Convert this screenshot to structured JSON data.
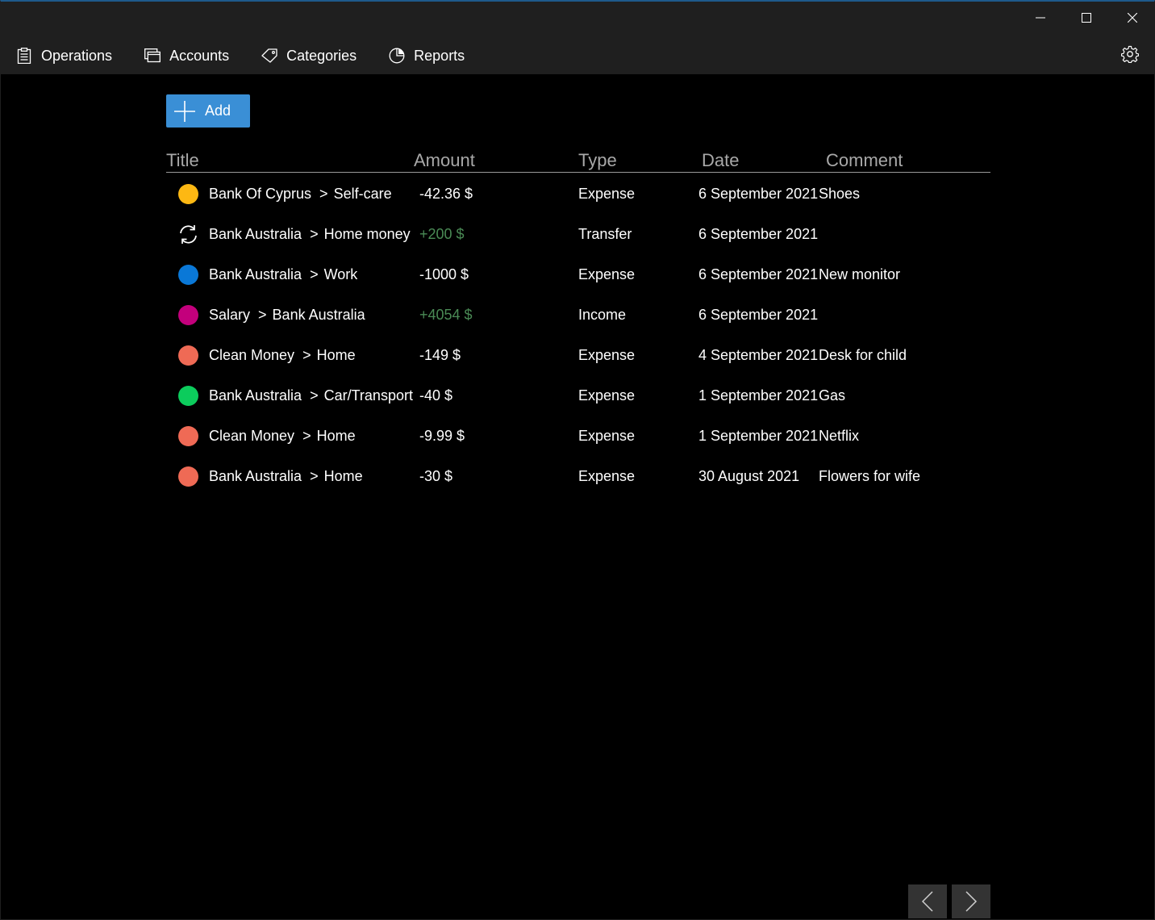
{
  "window": {
    "minimize_icon": "minimize-icon",
    "maximize_icon": "maximize-icon",
    "close_icon": "close-icon"
  },
  "nav": {
    "items": [
      {
        "label": "Operations",
        "icon": "clipboard-icon"
      },
      {
        "label": "Accounts",
        "icon": "accounts-icon"
      },
      {
        "label": "Categories",
        "icon": "tag-icon"
      },
      {
        "label": "Reports",
        "icon": "pie-chart-icon"
      }
    ],
    "settings_icon": "gear-icon"
  },
  "toolbar": {
    "add_label": "Add"
  },
  "table": {
    "headers": {
      "title": "Title",
      "amount": "Amount",
      "type": "Type",
      "date": "Date",
      "comment": "Comment"
    },
    "rows": [
      {
        "marker": "dot",
        "color": "#fdb813",
        "from": "Bank Of Cyprus",
        "to": "Self-care",
        "amount": "-42.36 $",
        "positive": false,
        "type": "Expense",
        "date": "6 September 2021",
        "comment": "Shoes"
      },
      {
        "marker": "transfer",
        "color": "#ffffff",
        "from": "Bank Australia",
        "to": "Home money",
        "amount": "+200 $",
        "positive": true,
        "type": "Transfer",
        "date": "6 September 2021",
        "comment": ""
      },
      {
        "marker": "dot",
        "color": "#0a78d7",
        "from": "Bank Australia",
        "to": "Work",
        "amount": "-1000 $",
        "positive": false,
        "type": "Expense",
        "date": "6 September 2021",
        "comment": "New monitor"
      },
      {
        "marker": "dot",
        "color": "#c3007c",
        "from": "Salary",
        "to": "Bank Australia",
        "amount": "+4054 $",
        "positive": true,
        "type": "Income",
        "date": "6 September 2021",
        "comment": ""
      },
      {
        "marker": "dot",
        "color": "#ef6a55",
        "from": "Clean Money",
        "to": "Home",
        "amount": "-149 $",
        "positive": false,
        "type": "Expense",
        "date": "4 September 2021",
        "comment": "Desk for child"
      },
      {
        "marker": "dot",
        "color": "#0ccc5c",
        "from": "Bank Australia",
        "to": "Car/Transport",
        "amount": "-40 $",
        "positive": false,
        "type": "Expense",
        "date": "1 September 2021",
        "comment": "Gas"
      },
      {
        "marker": "dot",
        "color": "#ef6a55",
        "from": "Clean Money",
        "to": "Home",
        "amount": "-9.99 $",
        "positive": false,
        "type": "Expense",
        "date": "1 September 2021",
        "comment": "Netflix"
      },
      {
        "marker": "dot",
        "color": "#ef6a55",
        "from": "Bank Australia",
        "to": "Home",
        "amount": "-30 $",
        "positive": false,
        "type": "Expense",
        "date": "30 August 2021",
        "comment": "Flowers for wife"
      }
    ]
  },
  "pager": {
    "prev_icon": "chevron-left-icon",
    "next_icon": "chevron-right-icon"
  },
  "colors": {
    "accent": "#3a8fd6",
    "positive_amount": "#4a8a55",
    "titlebar": "#1f1f1f"
  }
}
